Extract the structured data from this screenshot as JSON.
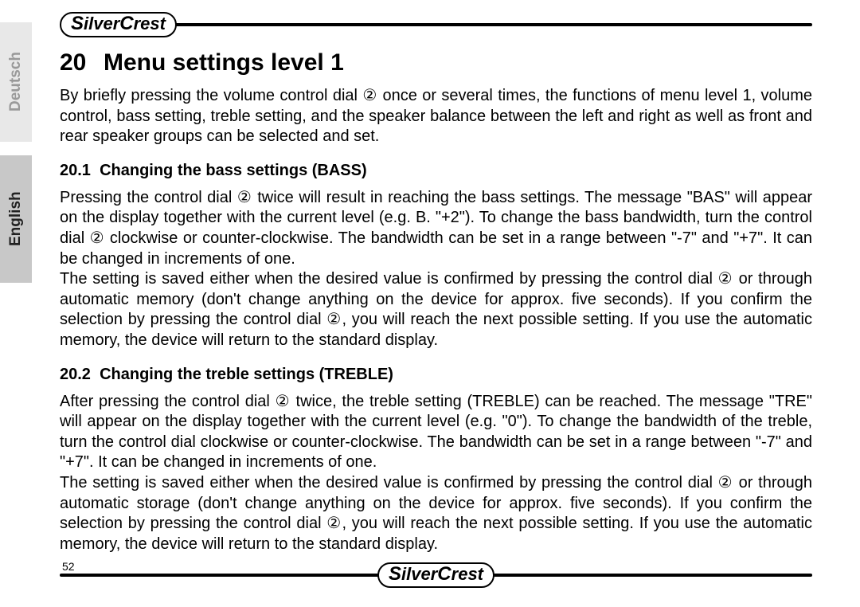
{
  "sidebar": {
    "tab_deutsch": "Deutsch",
    "tab_english": "English"
  },
  "logo": {
    "part1": "S",
    "part2": "ilver",
    "part3": "C",
    "part4": "rest"
  },
  "heading": {
    "number": "20",
    "title": "Menu settings level 1"
  },
  "intro": "By briefly pressing the volume control dial ② once or several times, the functions of menu level 1, volume control, bass setting, treble setting, and the speaker balance between the left and right as well as front and rear speaker groups can be selected and set.",
  "sections": [
    {
      "number": "20.1",
      "title": "Changing the bass settings (BASS)",
      "p1": "Pressing the control dial ② twice will result in reaching the bass settings. The message \"BAS\" will appear on the display together with the current level (e.g.  B. \"+2\"). To change the bass bandwidth, turn the control dial ② clockwise or counter-clockwise. The bandwidth can be set in a range between \"-7\" and \"+7\". It can be changed in increments of one.",
      "p2": "The setting is saved either when the desired value is confirmed by pressing the control dial ② or through automatic memory (don't change anything on the device for approx. five seconds). If you confirm the selection by pressing the control dial ②, you will reach the next possible setting. If you use the automatic memory, the device will return to the standard display."
    },
    {
      "number": "20.2",
      "title": "Changing the treble settings (TREBLE)",
      "p1": "After pressing the control dial ② twice, the treble setting (TREBLE) can be reached. The message \"TRE\" will appear on the display together with the current level (e.g. \"0\"). To change the bandwidth of the treble, turn the control dial clockwise or counter-clockwise. The bandwidth can be set in a range between \"-7\" and \"+7\". It can be changed in increments of one.",
      "p2": "The setting is saved either when the desired value is confirmed by pressing the control dial ② or through automatic storage (don't change anything on the device for approx. five seconds). If you confirm the selection by pressing the control dial ②, you will reach the next possible setting. If you use the automatic memory, the device will return to the standard display."
    }
  ],
  "page_number": "52"
}
